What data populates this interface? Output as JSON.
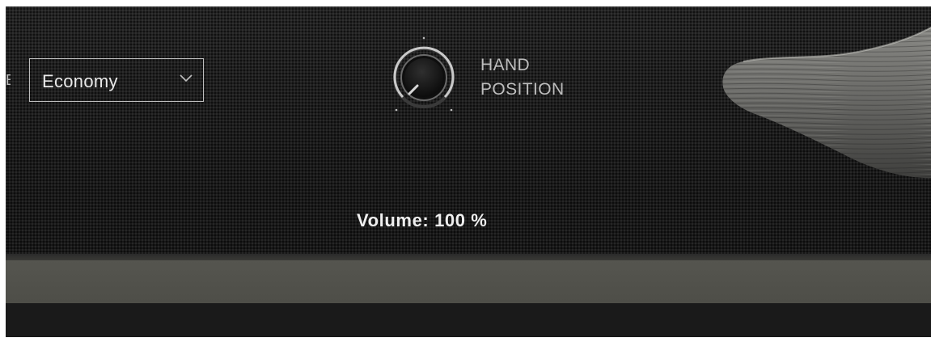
{
  "panel": {
    "left_label_fragment": "E",
    "dropdown": {
      "value": "Economy",
      "icon": "chevron-down-icon"
    },
    "knob": {
      "label_line1": "HAND",
      "label_line2": "POSITION",
      "icon": "rotary-knob"
    },
    "volume": {
      "text": "Volume: 100 %"
    }
  },
  "colors": {
    "panel_bg": "#1b1b1b",
    "strip": "#55554f",
    "bottom_bar": "#1a1a1a",
    "text": "#e9e9e9",
    "label": "#bdbdbd"
  }
}
